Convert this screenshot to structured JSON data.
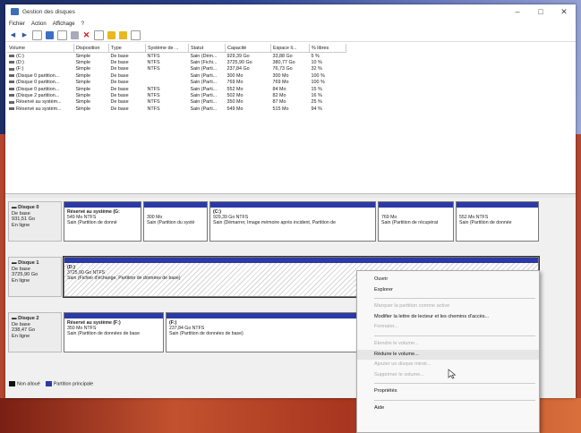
{
  "window": {
    "title": "Gestion des disques",
    "minimize": "–",
    "maximize": "□",
    "close": "✕"
  },
  "menu": [
    "Fichier",
    "Action",
    "Affichage",
    "?"
  ],
  "table": {
    "headers": [
      "Volume",
      "Disposition",
      "Type",
      "Système de ...",
      "Statut",
      "Capacité",
      "Espace li...",
      "% libres"
    ],
    "rows": [
      [
        "(C:)",
        "Simple",
        "De base",
        "NTFS",
        "Sain (Dém...",
        "929,39 Go",
        "33,88 Go",
        "5 %"
      ],
      [
        "(D:)",
        "Simple",
        "De base",
        "NTFS",
        "Sain (Fichi...",
        "3725,90 Go",
        "380,77 Go",
        "10 %"
      ],
      [
        "(F:)",
        "Simple",
        "De base",
        "NTFS",
        "Sain (Parti...",
        "237,84 Go",
        "76,73 Go",
        "32 %"
      ],
      [
        "(Disque 0 partition...",
        "Simple",
        "De base",
        "",
        "Sain (Parti...",
        "300 Mo",
        "300 Mo",
        "100 %"
      ],
      [
        "(Disque 0 partition...",
        "Simple",
        "De base",
        "",
        "Sain (Parti...",
        "769 Mo",
        "769 Mo",
        "100 %"
      ],
      [
        "(Disque 0 partition...",
        "Simple",
        "De base",
        "NTFS",
        "Sain (Parti...",
        "552 Mo",
        "84 Mo",
        "15 %"
      ],
      [
        "(Disque 2 partition...",
        "Simple",
        "De base",
        "NTFS",
        "Sain (Parti...",
        "502 Mo",
        "82 Mo",
        "16 %"
      ],
      [
        "Réservé au systèm...",
        "Simple",
        "De base",
        "NTFS",
        "Sain (Parti...",
        "350 Mo",
        "87 Mo",
        "25 %"
      ],
      [
        "Réservé au systèm...",
        "Simple",
        "De base",
        "NTFS",
        "Sain (Parti...",
        "549 Mo",
        "515 Mo",
        "94 %"
      ]
    ]
  },
  "disks": [
    {
      "name": "Disque 0",
      "type": "De base",
      "size": "931,51 Go",
      "status": "En ligne",
      "partitions": [
        {
          "title": "Réservé au système (G:",
          "size": "549 Mo NTFS",
          "status": "Sain (Partition de donné"
        },
        {
          "title": "",
          "size": "300 Mo",
          "status": "Sain (Partition du systè"
        },
        {
          "title": "(C:)",
          "size": "929,39 Go NTFS",
          "status": "Sain (Démarrer, Image mémoire après incident, Partition de"
        },
        {
          "title": "",
          "size": "769 Mo",
          "status": "Sain (Partition de récupérat"
        },
        {
          "title": "",
          "size": "552 Mo NTFS",
          "status": "Sain (Partition de donnée"
        }
      ]
    },
    {
      "name": "Disque 1",
      "type": "De base",
      "size": "3725,90 Go",
      "status": "En ligne",
      "partitions": [
        {
          "title": "(D:)",
          "size": "3725,90 Go NTFS",
          "status": "Sain (Fichier d'échange, Partition de données de base)"
        }
      ]
    },
    {
      "name": "Disque 2",
      "type": "De base",
      "size": "238,47 Go",
      "status": "En ligne",
      "partitions": [
        {
          "title": "Réservé au système (F:)",
          "size": "350 Mo NTFS",
          "status": "Sain (Partition de données de base"
        },
        {
          "title": "(F:)",
          "size": "237,84 Go NTFS",
          "status": "Sain (Partition de données de base)"
        }
      ]
    }
  ],
  "legend": [
    "Non alloué",
    "Partition principale"
  ],
  "context_menu": [
    {
      "label": "Ouvrir",
      "disabled": false
    },
    {
      "label": "Explorer",
      "disabled": false
    },
    {
      "sep": true
    },
    {
      "label": "Marquer la partition comme active",
      "disabled": true
    },
    {
      "label": "Modifier la lettre de lecteur et les chemins d'accès...",
      "disabled": false
    },
    {
      "label": "Formater...",
      "disabled": true
    },
    {
      "sep": true
    },
    {
      "label": "Étendre le volume...",
      "disabled": true
    },
    {
      "label": "Réduire le volume...",
      "disabled": false
    },
    {
      "label": "Ajouter un disque miroir...",
      "disabled": true
    },
    {
      "label": "Supprimer le volume...",
      "disabled": true
    },
    {
      "sep": true
    },
    {
      "label": "Propriétés",
      "disabled": false
    },
    {
      "sep": true
    },
    {
      "label": "Aide",
      "disabled": false
    }
  ],
  "colors": {
    "primary_partition": "#2b3aa6",
    "unallocated": "#111111"
  }
}
